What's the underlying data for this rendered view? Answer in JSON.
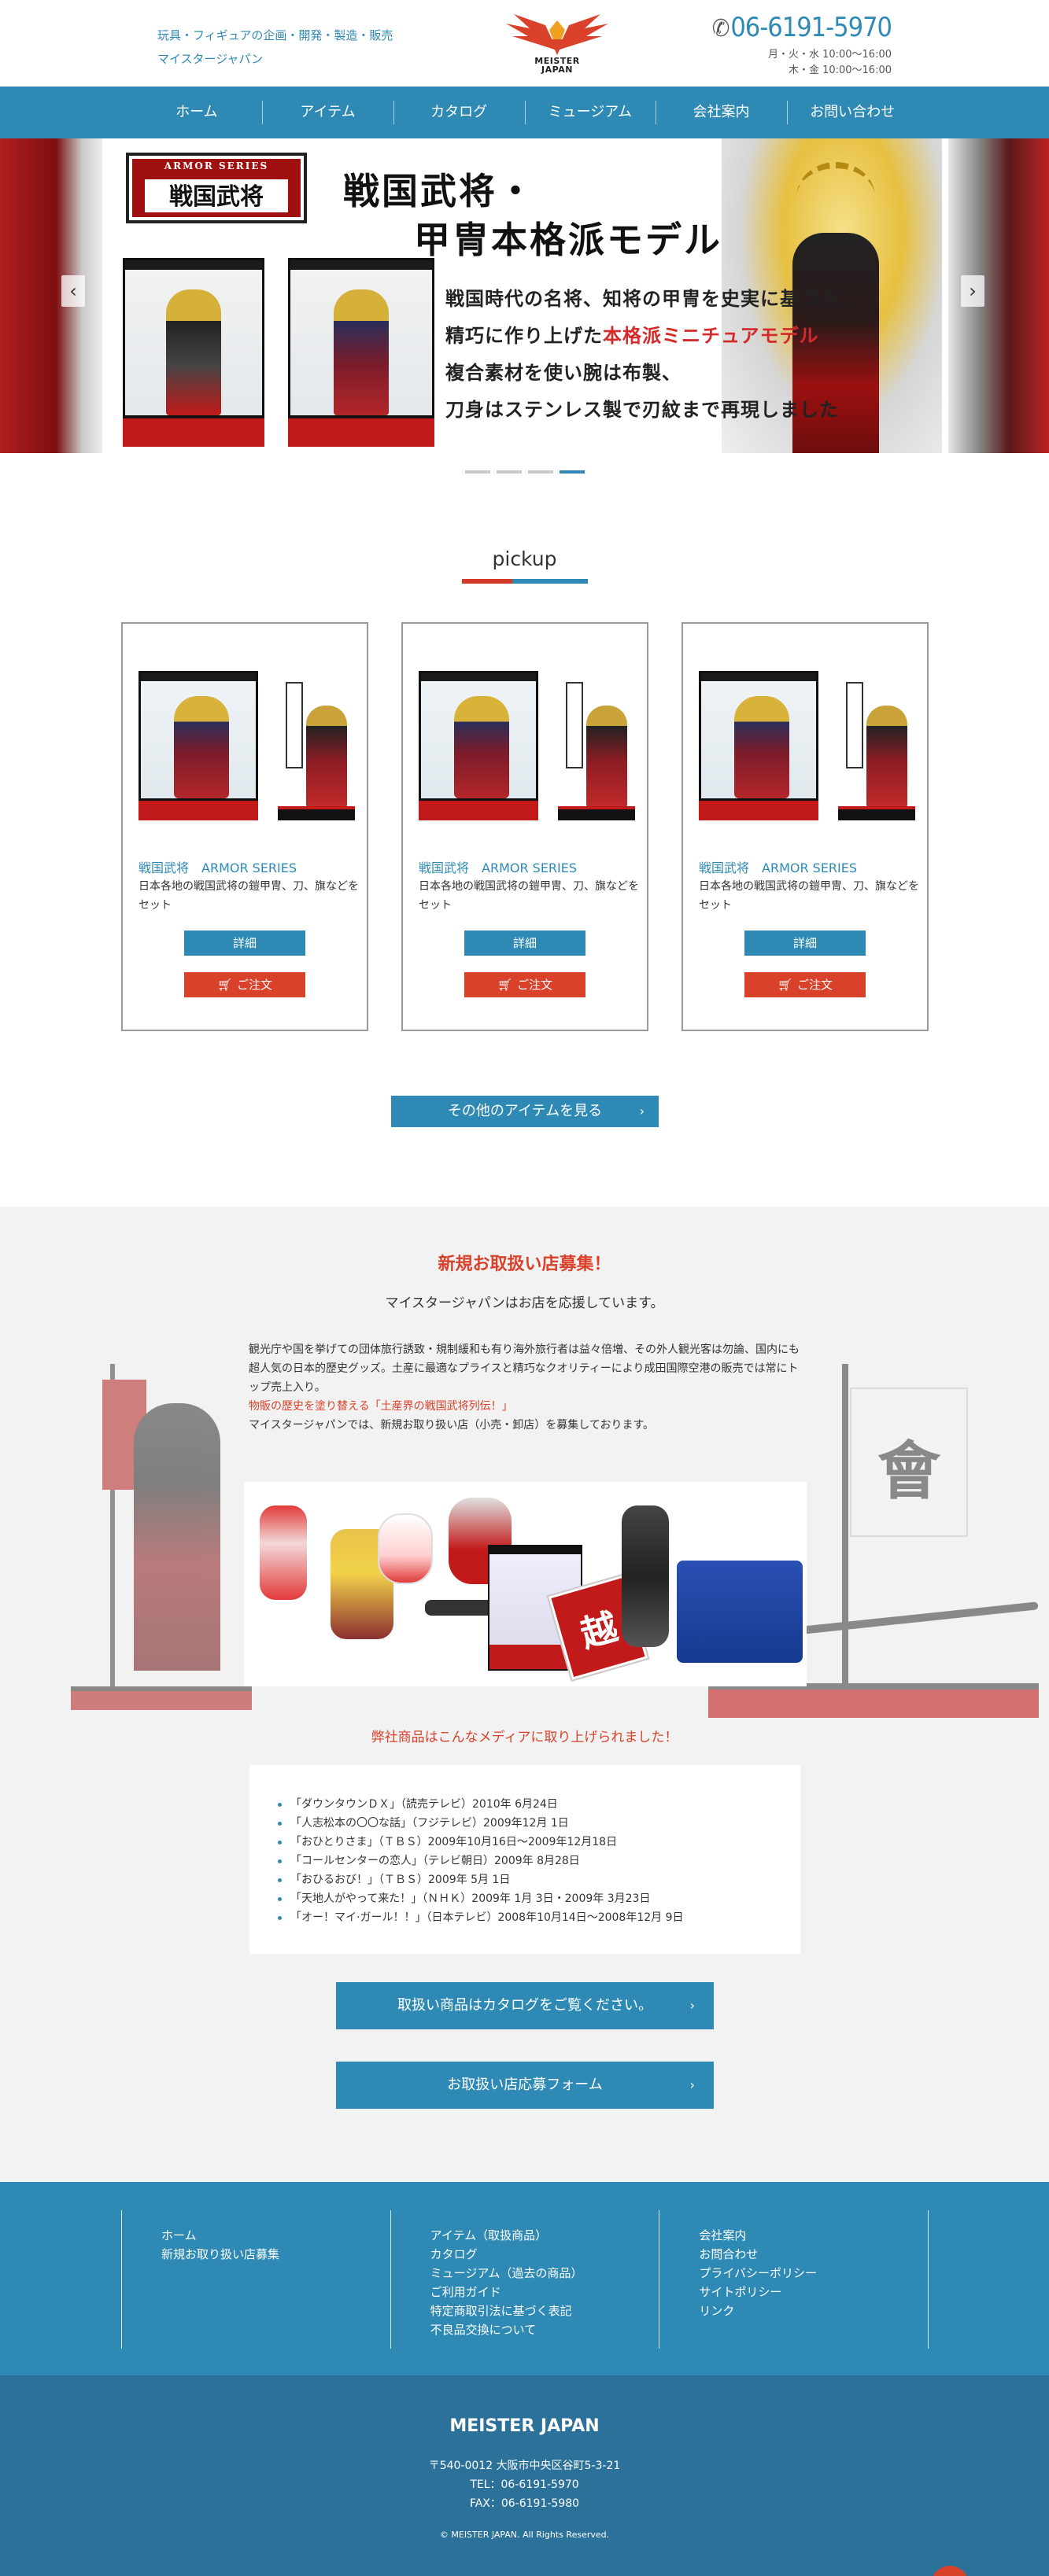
{
  "header": {
    "tagline_1": "玩具・フィギュアの企画・開発・製造・販売",
    "tagline_2": "マイスタージャパン",
    "logo_text_1": "MEISTER",
    "logo_text_2": "JAPAN",
    "phone": "06-6191-5970",
    "hours_1": "月・火・水 10:00〜16:00",
    "hours_2": "木・金 10:00〜16:00"
  },
  "nav": {
    "items": [
      "ホーム",
      "アイテム",
      "カタログ",
      "ミュージアム",
      "会社案内",
      "お問い合わせ"
    ]
  },
  "slider": {
    "series": "ARMOR SERIES",
    "label": "戦国武将",
    "title_1": "戦国武将・",
    "title_2": "甲冑本格派モデル",
    "copy_1": "戦国時代の名将、知将の甲冑を史実に基づき、",
    "copy_2a": "精巧に作り上げた",
    "copy_2b": "本格派ミニチュアモデル",
    "copy_3": "複合素材を使い腕は布製、",
    "copy_4": "刀身はステンレス製で刃紋まで再現しました",
    "prev": "‹",
    "next": "›",
    "dot_count": 4,
    "active_dot": 4
  },
  "pickup": {
    "title": "pickup",
    "cards": [
      {
        "brand": "戦国武将　ARMOR SERIES",
        "desc": "日本各地の戦国武将の鎧甲冑、刀、旗などをセット",
        "detail": "詳細",
        "order": "ご注文"
      },
      {
        "brand": "戦国武将　ARMOR SERIES",
        "desc": "日本各地の戦国武将の鎧甲冑、刀、旗などをセット",
        "detail": "詳細",
        "order": "ご注文"
      },
      {
        "brand": "戦国武将　ARMOR SERIES",
        "desc": "日本各地の戦国武将の鎧甲冑、刀、旗などをセット",
        "detail": "詳細",
        "order": "ご注文"
      }
    ],
    "more": "その他のアイテムを見る"
  },
  "recruit": {
    "title": "新規お取扱い店募集！",
    "subtitle": "マイスタージャパンはお店を応援しています。",
    "body_1": "観光庁や国を挙げての団体旅行誘致・規制緩和も有り海外旅行者は益々倍増、その外人観光客は勿論、国内にも超人気の日本的歴史グッズ。土産に最適なプライスと精巧なクオリティーにより成田国際空港の販売では常にトップ売上入り。",
    "body_red": "物販の歴史を塗り替える「土産界の戦国武将列伝！」",
    "body_2": "マイスタージャパンでは、新規お取り扱い店（小売・卸店）を募集しております。",
    "flag_char": "會",
    "stamp_char": "越",
    "media_title": "弊社商品はこんなメディアに取り上げられました！",
    "media": [
      "「ダウンタウンＤＸ」（読売テレビ）2010年 6月24日",
      "「人志松本の〇〇な話」（フジテレビ）2009年12月 1日",
      "「おひとりさま」（ＴＢＳ）2009年10月16日〜2009年12月18日",
      "「コールセンターの恋人」（テレビ朝日）2009年 8月28日",
      "「おひるおび！」（ＴＢＳ）2009年 5月 1日",
      "「天地人がやって来た！」（ＮＨＫ）2009年 1月 3日・2009年 3月23日",
      "「オー！マイ·ガール！！」（日本テレビ）2008年10月14日〜2008年12月 9日"
    ],
    "btn_catalog": "取扱い商品はカタログをご覧ください。",
    "btn_apply": "お取扱い店応募フォーム"
  },
  "footer_nav": {
    "col1": [
      "ホーム",
      "新規お取り扱い店募集"
    ],
    "col2": [
      "アイテム（取扱商品）",
      "カタログ",
      "ミュージアム（過去の商品）",
      "ご利用ガイド",
      "特定商取引法に基づく表記",
      "不良品交換について"
    ],
    "col3": [
      "会社案内",
      "お問合わせ",
      "プライバシーポリシー",
      "サイトポリシー",
      "リンク"
    ]
  },
  "footer": {
    "brand": "MEISTER JAPAN",
    "address": "〒540-0012 大阪市中央区谷町5-3-21",
    "tel": "TEL：06-6191-5970",
    "fax": "FAX：06-6191-5980",
    "copyright": "© MEISTER JAPAN. All Rights Reserved."
  },
  "colors": {
    "primary": "#2e8ab5",
    "accent_red": "#d9412a",
    "footer_dark": "#2b7199",
    "section_bg": "#f2f2f2"
  }
}
